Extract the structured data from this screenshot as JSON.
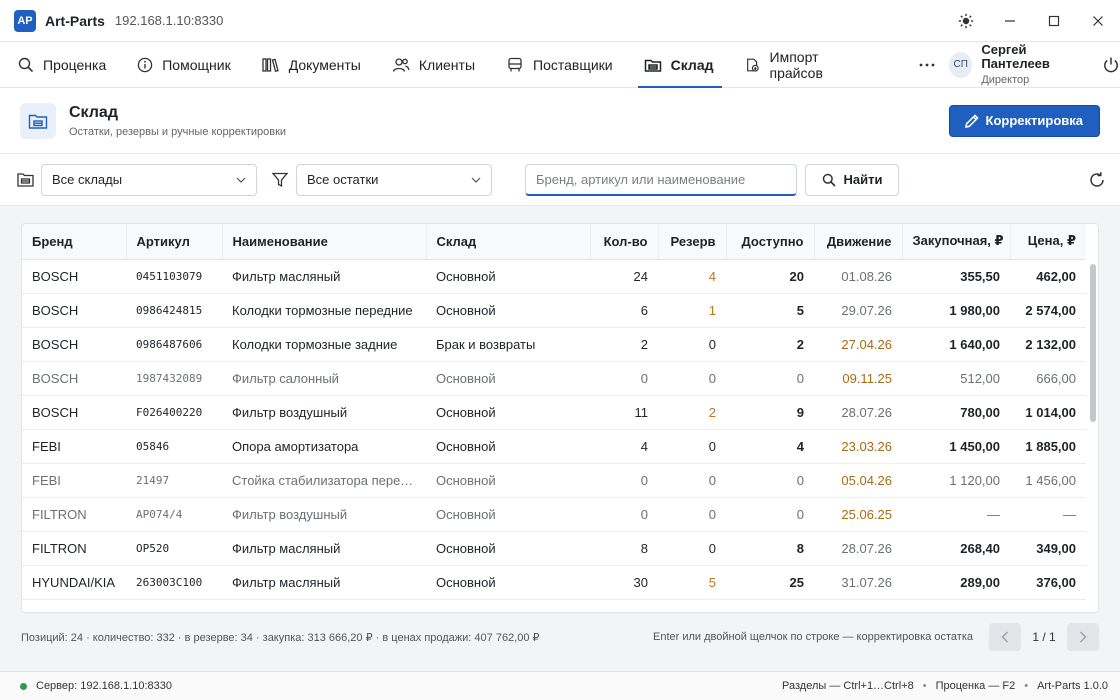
{
  "app": {
    "logo": "AP",
    "name": "Art-Parts",
    "host": "192.168.1.10:8330"
  },
  "nav": {
    "items": [
      {
        "label": "Проценка",
        "icon": "search-icon",
        "active": false
      },
      {
        "label": "Помощник",
        "icon": "info-icon",
        "active": false
      },
      {
        "label": "Документы",
        "icon": "documents-icon",
        "active": false
      },
      {
        "label": "Клиенты",
        "icon": "clients-icon",
        "active": false
      },
      {
        "label": "Поставщики",
        "icon": "truck-icon",
        "active": false
      },
      {
        "label": "Склад",
        "icon": "warehouse-icon",
        "active": true
      },
      {
        "label": "Импорт прайсов",
        "icon": "import-icon",
        "active": false
      }
    ],
    "more": "···"
  },
  "user": {
    "initials": "СП",
    "name": "Сергей Пантелеев",
    "role": "Директор"
  },
  "page": {
    "title": "Склад",
    "subtitle": "Остатки, резервы и ручные корректировки",
    "action_label": "Корректировка"
  },
  "filters": {
    "warehouse": "Все склады",
    "stock": "Все остатки",
    "search_placeholder": "Бренд, артикул или наименование",
    "find_label": "Найти"
  },
  "table": {
    "headers": {
      "brand": "Бренд",
      "article": "Артикул",
      "name": "Наименование",
      "warehouse": "Склад",
      "qty": "Кол-во",
      "reserve": "Резерв",
      "available": "Доступно",
      "movement": "Движение",
      "purchase": "Закупочная, ₽",
      "price": "Цена, ₽"
    },
    "rows": [
      {
        "brand": "BOSCH",
        "article": "0451103079",
        "name": "Фильтр масляный",
        "warehouse": "Основной",
        "qty": "24",
        "reserve": "4",
        "available": "20",
        "movement": "01.08.26",
        "purchase": "355,50",
        "price": "462,00",
        "dim": false,
        "move_warn": false
      },
      {
        "brand": "BOSCH",
        "article": "0986424815",
        "name": "Колодки тормозные передние",
        "warehouse": "Основной",
        "qty": "6",
        "reserve": "1",
        "available": "5",
        "movement": "29.07.26",
        "purchase": "1 980,00",
        "price": "2 574,00",
        "dim": false,
        "move_warn": false
      },
      {
        "brand": "BOSCH",
        "article": "0986487606",
        "name": "Колодки тормозные задние",
        "warehouse": "Брак и возвраты",
        "qty": "2",
        "reserve": "0",
        "available": "2",
        "movement": "27.04.26",
        "purchase": "1 640,00",
        "price": "2 132,00",
        "dim": false,
        "move_warn": true
      },
      {
        "brand": "BOSCH",
        "article": "1987432089",
        "name": "Фильтр салонный",
        "warehouse": "Основной",
        "qty": "0",
        "reserve": "0",
        "available": "0",
        "movement": "09.11.25",
        "purchase": "512,00",
        "price": "666,00",
        "dim": true,
        "move_warn": true
      },
      {
        "brand": "BOSCH",
        "article": "F026400220",
        "name": "Фильтр воздушный",
        "warehouse": "Основной",
        "qty": "11",
        "reserve": "2",
        "available": "9",
        "movement": "28.07.26",
        "purchase": "780,00",
        "price": "1 014,00",
        "dim": false,
        "move_warn": false
      },
      {
        "brand": "FEBI",
        "article": "05846",
        "name": "Опора амортизатора",
        "warehouse": "Основной",
        "qty": "4",
        "reserve": "0",
        "available": "4",
        "movement": "23.03.26",
        "purchase": "1 450,00",
        "price": "1 885,00",
        "dim": false,
        "move_warn": true
      },
      {
        "brand": "FEBI",
        "article": "21497",
        "name": "Стойка стабилизатора передняя",
        "warehouse": "Основной",
        "qty": "0",
        "reserve": "0",
        "available": "0",
        "movement": "05.04.26",
        "purchase": "1 120,00",
        "price": "1 456,00",
        "dim": true,
        "move_warn": true
      },
      {
        "brand": "FILTRON",
        "article": "AP074/4",
        "name": "Фильтр воздушный",
        "warehouse": "Основной",
        "qty": "0",
        "reserve": "0",
        "available": "0",
        "movement": "25.06.25",
        "purchase": "—",
        "price": "—",
        "dim": true,
        "move_warn": true
      },
      {
        "brand": "FILTRON",
        "article": "OP520",
        "name": "Фильтр масляный",
        "warehouse": "Основной",
        "qty": "8",
        "reserve": "0",
        "available": "8",
        "movement": "28.07.26",
        "purchase": "268,40",
        "price": "349,00",
        "dim": false,
        "move_warn": false
      },
      {
        "brand": "HYUNDAI/KIA",
        "article": "263003C100",
        "name": "Фильтр масляный",
        "warehouse": "Основной",
        "qty": "30",
        "reserve": "5",
        "available": "25",
        "movement": "31.07.26",
        "purchase": "289,00",
        "price": "376,00",
        "dim": false,
        "move_warn": false
      }
    ]
  },
  "summary": {
    "totals": "Позиций: 24 · количество: 332 · в резерве: 34 · закупка: 313 666,20 ₽ · в ценах продажи: 407 762,00 ₽",
    "hint": "Enter или двойной щелчок по строке — корректировка остатка",
    "page": "1 / 1"
  },
  "status": {
    "server": "Сервер: 192.168.1.10:8330",
    "shortcut_sections": "Разделы — Ctrl+1…Ctrl+8",
    "shortcut_pricing": "Проценка — F2",
    "version": "Art-Parts 1.0.0"
  },
  "colors": {
    "accent": "#1f5fbf",
    "warning": "#a86a12",
    "ok": "#2e9b4a"
  }
}
